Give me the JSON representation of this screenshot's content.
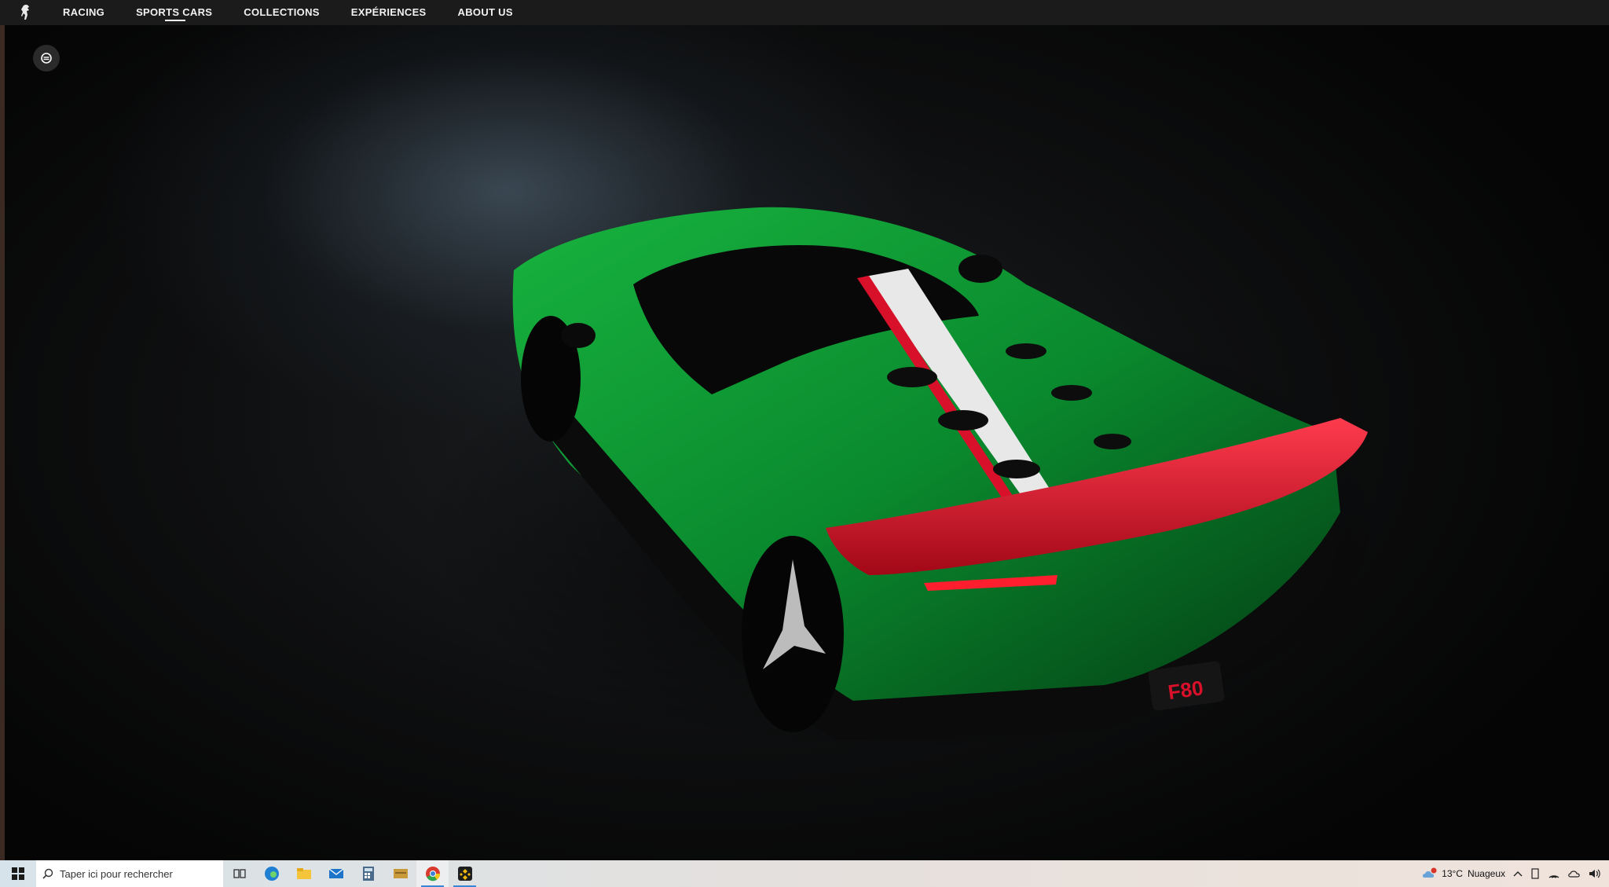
{
  "nav": {
    "items": [
      {
        "label": "RACING"
      },
      {
        "label": "SPORTS CARS"
      },
      {
        "label": "COLLECTIONS"
      },
      {
        "label": "EXPÉRIENCES"
      },
      {
        "label": "ABOUT US"
      }
    ],
    "active_index": 1
  },
  "icons": {
    "logo": "prancing-horse-icon",
    "view_toggle": "view-toggle-icon"
  },
  "car": {
    "body_color": "#0a8a2e",
    "wing_color": "#d8102a",
    "stripe_colors": [
      "#d8102a",
      "#e8e8e8"
    ],
    "badge_text": "F80"
  },
  "taskbar": {
    "search_placeholder": "Taper ici pour rechercher",
    "apps": [
      "task-view-icon",
      "edge-icon",
      "file-explorer-icon",
      "mail-icon",
      "calculator-icon",
      "folder-icon",
      "chrome-icon",
      "binance-icon"
    ],
    "weather": {
      "temp": "13°C",
      "condition": "Nuageux",
      "badge": "1"
    }
  }
}
